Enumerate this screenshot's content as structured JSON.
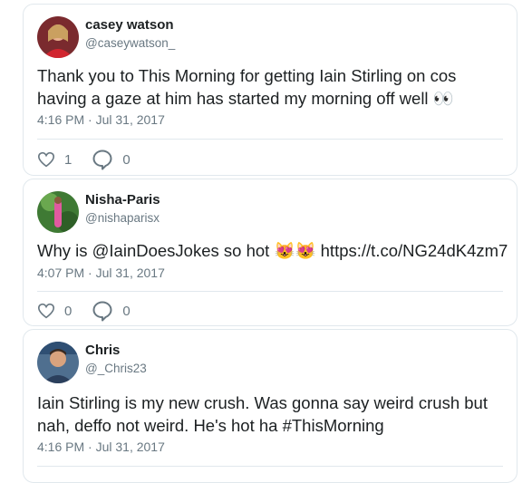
{
  "tweets": [
    {
      "name": "casey watson",
      "handle": "@caseywatson_",
      "text": "Thank you to This Morning for getting Iain Stirling on cos having a gaze at him has started my morning off well 👀",
      "time": "4:16 PM · Jul 31, 2017",
      "likes": "1",
      "replies": "0",
      "avatar_color": "#d1252f"
    },
    {
      "name": "Nisha-Paris",
      "handle": "@nishaparisx",
      "text": "Why is @IainDoesJokes so hot 😻😻 https://t.co/NG24dK4zm7",
      "time": "4:07 PM · Jul 31, 2017",
      "likes": "0",
      "replies": "0",
      "avatar_color": "#4a8a3c"
    },
    {
      "name": "Chris",
      "handle": "@_Chris23",
      "text": "Iain Stirling is my new crush. Was gonna say weird crush but nah, deffo not weird. He's hot ha #ThisMorning",
      "time": "4:16 PM · Jul 31, 2017",
      "avatar_color": "#2f4f73"
    }
  ],
  "icons": {
    "like": "heart-outline-icon",
    "reply": "speech-bubble-icon"
  },
  "colors": {
    "text": "#1c2022",
    "muted": "#697882",
    "border": "#e1e8ed"
  }
}
